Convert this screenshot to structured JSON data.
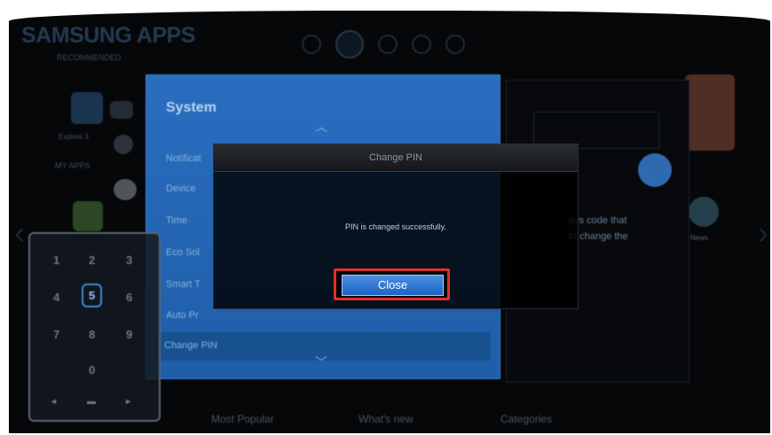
{
  "app": {
    "brand": "SAMSUNG APPS",
    "recommended_label": "RECOMMENDED",
    "my_apps_label": "MY APPS",
    "explore_label": "Explore 3",
    "news_label": "News"
  },
  "top_icons": [
    "games-icon",
    "apps-icon",
    "photos-icon",
    "video-icon",
    "social-icon"
  ],
  "settings_panel": {
    "title": "System",
    "items": [
      {
        "label": "Notificat"
      },
      {
        "label": "Device"
      },
      {
        "label": "Time"
      },
      {
        "label": "Eco Sol"
      },
      {
        "label": "Smart T"
      },
      {
        "label": "Auto Pr"
      },
      {
        "label": "Change PIN"
      }
    ]
  },
  "right_panel": {
    "line1": "ays code that",
    "line2": "to change the"
  },
  "keypad": {
    "keys": [
      "1",
      "2",
      "3",
      "4",
      "5",
      "6",
      "7",
      "8",
      "9",
      "0"
    ]
  },
  "dialog": {
    "title": "Change PIN",
    "message": "PIN is changed successfully.",
    "close_label": "Close"
  },
  "bottom_nav": {
    "most_popular": "Most Popular",
    "whats_new": "What's new",
    "categories": "Categories"
  },
  "colors": {
    "panel_blue": "#2a6ec0",
    "highlight_red": "#e0302a",
    "button_blue": "#1d64c4"
  }
}
